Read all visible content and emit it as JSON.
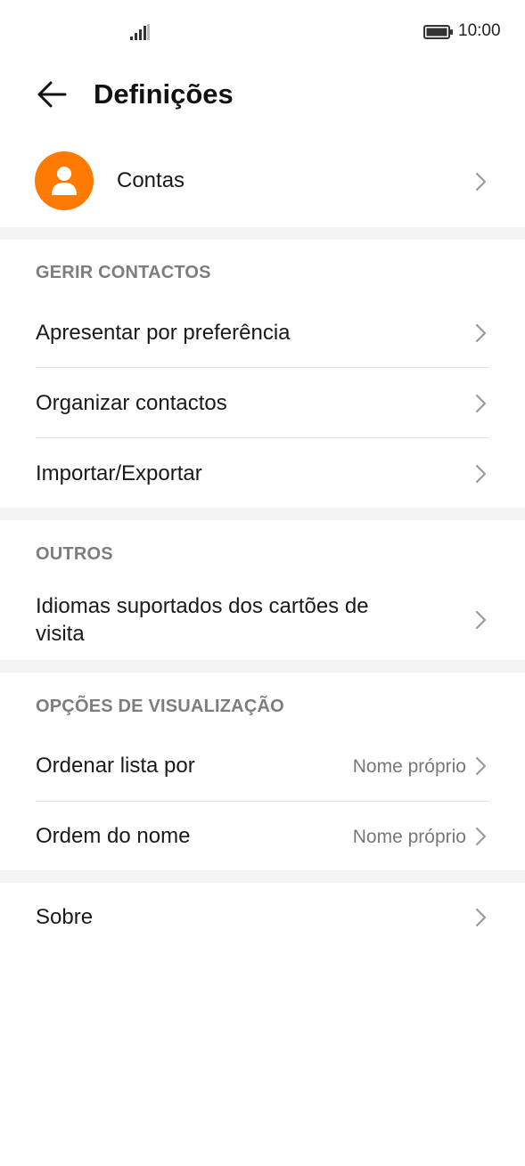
{
  "status_bar": {
    "time": "10:00"
  },
  "header": {
    "title": "Definições"
  },
  "accounts": {
    "label": "Contas"
  },
  "sections": {
    "manage": {
      "heading": "GERIR CONTACTOS",
      "items": [
        {
          "label": "Apresentar por preferência"
        },
        {
          "label": "Organizar contactos"
        },
        {
          "label": "Importar/Exportar"
        }
      ]
    },
    "others": {
      "heading": "OUTROS",
      "items": [
        {
          "label_line1": "Idiomas suportados dos cartões de",
          "label_line2": "visita"
        }
      ]
    },
    "display": {
      "heading": "OPÇÕES DE VISUALIZAÇÃO",
      "items": [
        {
          "label": "Ordenar lista por",
          "value": "Nome próprio"
        },
        {
          "label": "Ordem do nome",
          "value": "Nome próprio"
        }
      ]
    }
  },
  "about": {
    "label": "Sobre"
  },
  "colors": {
    "accent": "#ff7a00",
    "band": "#f4f4f4",
    "secondary_text": "#7d7d7d"
  },
  "icons": [
    "signal-icon",
    "battery-icon",
    "back-arrow-icon",
    "account-avatar-icon",
    "chevron-right-icon"
  ]
}
